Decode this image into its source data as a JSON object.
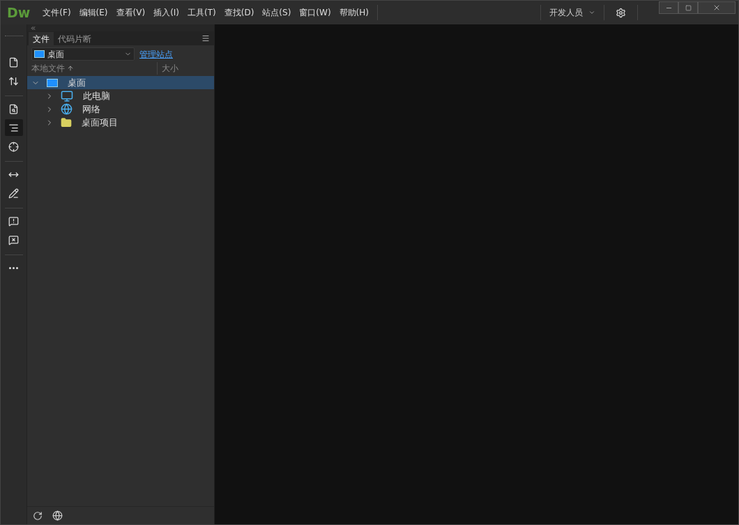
{
  "app": {
    "logo": "Dw"
  },
  "menu": [
    "文件(F)",
    "编辑(E)",
    "查看(V)",
    "插入(I)",
    "工具(T)",
    "查找(D)",
    "站点(S)",
    "窗口(W)",
    "帮助(H)"
  ],
  "workspace": {
    "label": "开发人员"
  },
  "toolbar": [
    {
      "kind": "file",
      "selected": false
    },
    {
      "kind": "transfer",
      "selected": false
    },
    {
      "kind": "preview",
      "selected": false
    },
    {
      "kind": "outline",
      "selected": true
    },
    {
      "kind": "target",
      "selected": false
    },
    {
      "kind": "expand",
      "selected": false
    },
    {
      "kind": "code",
      "selected": false
    },
    {
      "kind": "comment",
      "selected": false
    },
    {
      "kind": "uncomment",
      "selected": false
    },
    {
      "kind": "more",
      "selected": false
    }
  ],
  "tabs": [
    {
      "label": "文件",
      "selected": true
    },
    {
      "label": "代码片断",
      "selected": false
    }
  ],
  "site_select": {
    "value": "桌面"
  },
  "manage_link": "管理站点",
  "columns": [
    {
      "label": "本地文件",
      "sorted": true
    },
    {
      "label": "大小",
      "sorted": false
    }
  ],
  "tree": [
    {
      "name": "桌面",
      "kind": "desktop",
      "expanded": true,
      "selected": true,
      "children": [
        {
          "name": "此电脑",
          "kind": "computer",
          "expanded": false,
          "selected": false
        },
        {
          "name": "网络",
          "kind": "network",
          "expanded": false,
          "selected": false
        },
        {
          "name": "桌面项目",
          "kind": "folder",
          "expanded": false,
          "selected": false
        }
      ]
    }
  ]
}
